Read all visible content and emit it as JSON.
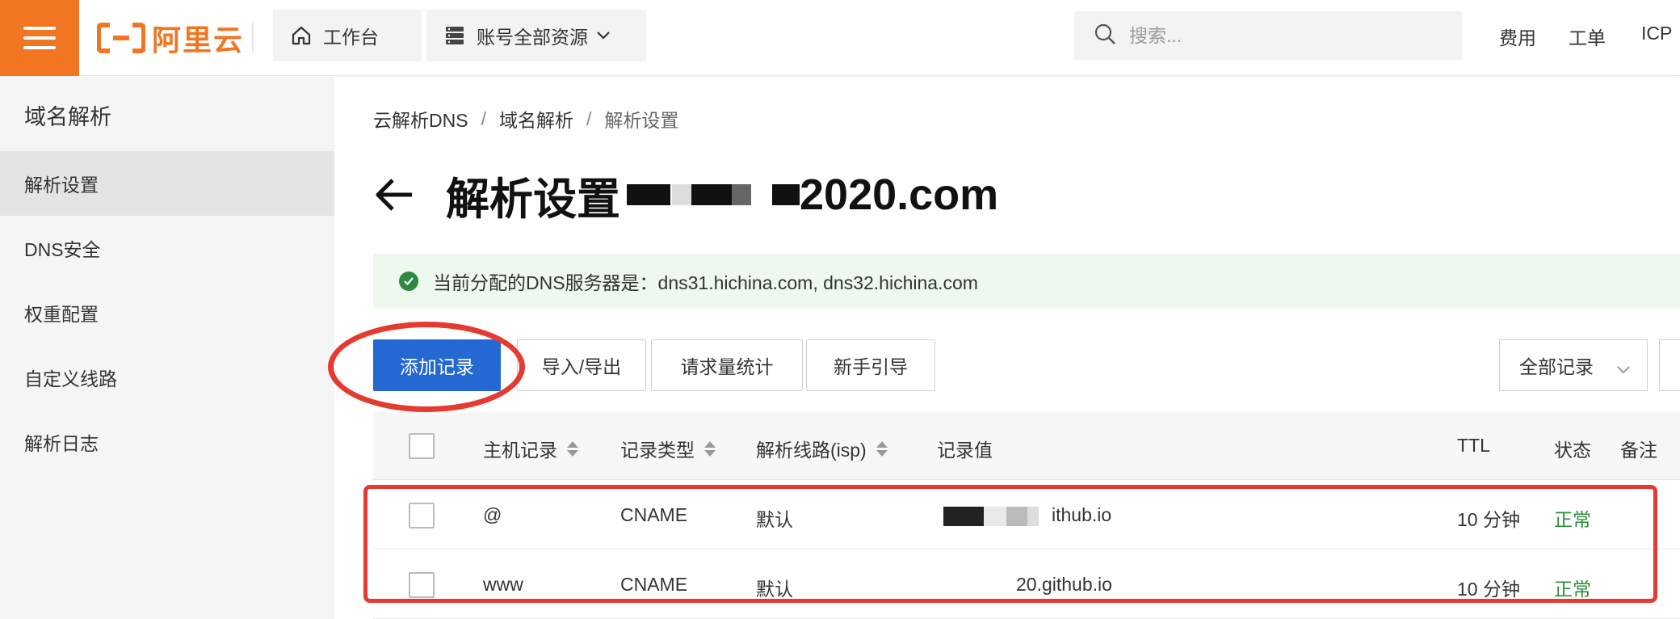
{
  "topbar": {
    "brand": "阿里云",
    "workbench_label": "工作台",
    "resources_label": "账号全部资源",
    "search_placeholder": "搜索...",
    "links": [
      "费用",
      "工单",
      "ICP"
    ]
  },
  "sidebar": {
    "title": "域名解析",
    "items": [
      {
        "label": "解析设置",
        "active": true
      },
      {
        "label": "DNS安全",
        "active": false
      },
      {
        "label": "权重配置",
        "active": false
      },
      {
        "label": "自定义线路",
        "active": false
      },
      {
        "label": "解析日志",
        "active": false
      }
    ]
  },
  "breadcrumb": [
    "云解析DNS",
    "域名解析",
    "解析设置"
  ],
  "page": {
    "title": "解析设置",
    "domain_suffix": "2020.com"
  },
  "alert": {
    "text": "当前分配的DNS服务器是：dns31.hichina.com, dns32.hichina.com"
  },
  "toolbar": {
    "add_label": "添加记录",
    "import_label": "导入/导出",
    "stats_label": "请求量统计",
    "guide_label": "新手引导",
    "filter_label": "全部记录"
  },
  "table": {
    "headers": {
      "host": "主机记录",
      "type": "记录类型",
      "line": "解析线路(isp)",
      "value": "记录值",
      "ttl": "TTL",
      "status": "状态",
      "remark": "备注"
    },
    "rows": [
      {
        "host": "@",
        "type": "CNAME",
        "line": "默认",
        "value": "ithub.io",
        "ttl": "10 分钟",
        "status": "正常"
      },
      {
        "host": "www",
        "type": "CNAME",
        "line": "默认",
        "value": "20.github.io",
        "ttl": "10 分钟",
        "status": "正常"
      }
    ]
  },
  "colors": {
    "brand_orange": "#f27621",
    "primary_blue": "#2468d3",
    "annotation_red": "#e53a2f",
    "status_green": "#2f8a3f"
  }
}
